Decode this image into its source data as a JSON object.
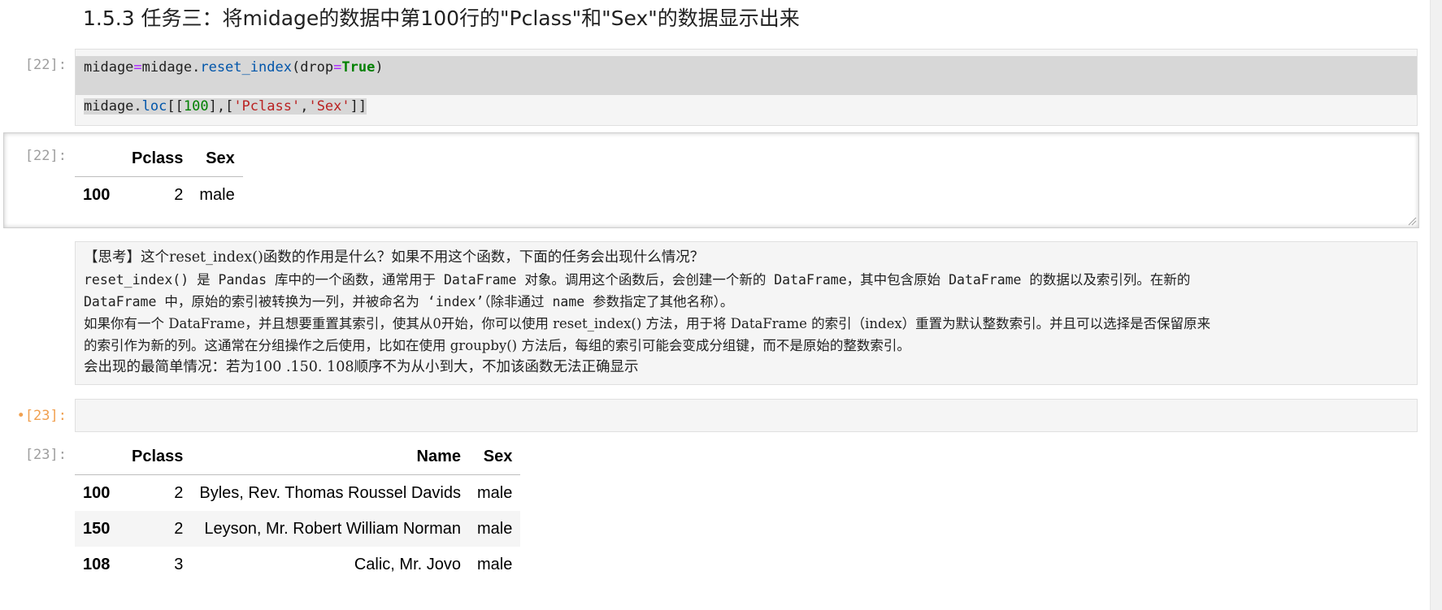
{
  "heading": "1.5.3 任务三：将midage的数据中第100行的\"Pclass\"和\"Sex\"的数据显示出来",
  "cell22": {
    "prompt_in": "[22]:",
    "code": {
      "line1": {
        "var": "midage",
        "op": "=",
        "obj": "midage",
        "dot": ".",
        "method": "reset_index",
        "open": "(",
        "arg": "drop",
        "eq": "=",
        "kw": "True",
        "close": ")"
      },
      "line2": {
        "obj": "midage",
        "dot": ".",
        "method": "loc",
        "b1": "[[",
        "num": "100",
        "b2": "],[",
        "s1": "'Pclass'",
        "comma": ",",
        "s2": "'Sex'",
        "b3": "]]"
      }
    },
    "prompt_out": "[22]:",
    "output": {
      "columns": [
        "Pclass",
        "Sex"
      ],
      "rows": [
        {
          "index": "100",
          "Pclass": "2",
          "Sex": "male"
        }
      ]
    }
  },
  "markdown": {
    "p1": "【思考】这个reset_index()函数的作用是什么？如果不用这个函数，下面的任务会出现什么情况？",
    "p2a": "reset_index() 是 Pandas 库中的一个函数，通常用于 DataFrame 对象。调用这个函数后，会创建一个新的 DataFrame，其中包含原始 DataFrame 的数据以及索引列。在新的",
    "p2b": "DataFrame 中，原始的索引被转换为一列，并被命名为 ‘index’（除非通过 name 参数指定了其他名称）。",
    "p3a": "如果你有一个 DataFrame，并且想要重置其索引，使其从0开始，你可以使用 reset_index() 方法，用于将 DataFrame 的索引（index）重置为默认整数索引。并且可以选择是否保留原来",
    "p3b": "的索引作为新的列。这通常在分组操作之后使用，比如在使用 groupby() 方法后，每组的索引可能会变成分组键，而不是原始的整数索引。",
    "p4": "会出现的最简单情况：若为100 .150. 108顺序不为从小到大，不加该函数无法正确显示"
  },
  "cell23": {
    "prompt_in_dot": "•",
    "prompt_in": "[23]:",
    "prompt_out": "[23]:",
    "output": {
      "columns": [
        "Pclass",
        "Name",
        "Sex"
      ],
      "rows": [
        {
          "index": "100",
          "Pclass": "2",
          "Name": "Byles, Rev. Thomas Roussel Davids",
          "Sex": "male"
        },
        {
          "index": "150",
          "Pclass": "2",
          "Name": "Leyson, Mr. Robert William Norman",
          "Sex": "male"
        },
        {
          "index": "108",
          "Pclass": "3",
          "Name": "Calic, Mr. Jovo",
          "Sex": "male"
        }
      ]
    }
  }
}
